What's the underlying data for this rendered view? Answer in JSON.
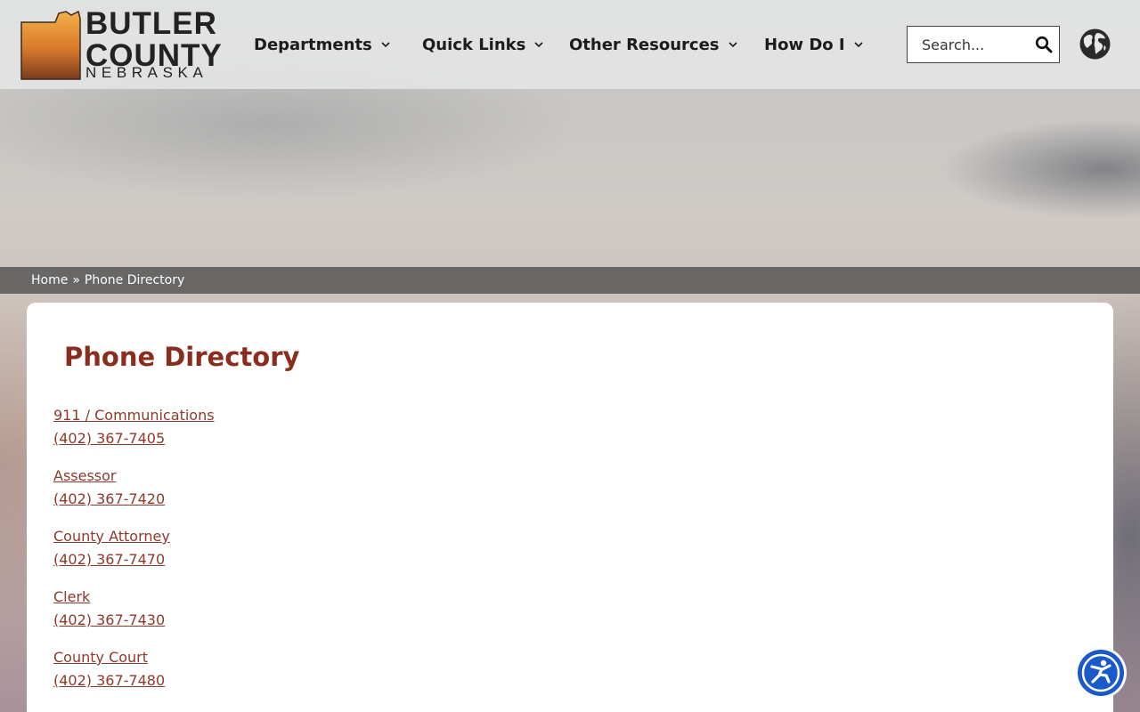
{
  "logo": {
    "line1": "BUTLER",
    "line2": "COUNTY",
    "line3": "NEBRASKA"
  },
  "nav": {
    "items": [
      {
        "label": "Departments"
      },
      {
        "label": "Quick Links"
      },
      {
        "label": "Other Resources"
      },
      {
        "label": "How Do I"
      }
    ]
  },
  "search": {
    "placeholder": "Search..."
  },
  "breadcrumb": {
    "home": "Home",
    "separator": "»",
    "current": "Phone Directory"
  },
  "page": {
    "title": "Phone Directory"
  },
  "directory": [
    {
      "department": "911 / Communications",
      "phone": "(402) 367-7405"
    },
    {
      "department": "Assessor",
      "phone": "(402) 367-7420"
    },
    {
      "department": "County Attorney",
      "phone": "(402) 367-7470"
    },
    {
      "department": "Clerk",
      "phone": "(402) 367-7430"
    },
    {
      "department": "County Court",
      "phone": "(402) 367-7480"
    }
  ],
  "colors": {
    "accent": "#8b2d1e",
    "link": "#8b3a2c",
    "accessibility": "#1a59c9"
  },
  "icons": {
    "search": "search-icon",
    "language": "globe-icon",
    "dropdown": "chevron-down-icon",
    "accessibility": "accessibility-icon"
  }
}
